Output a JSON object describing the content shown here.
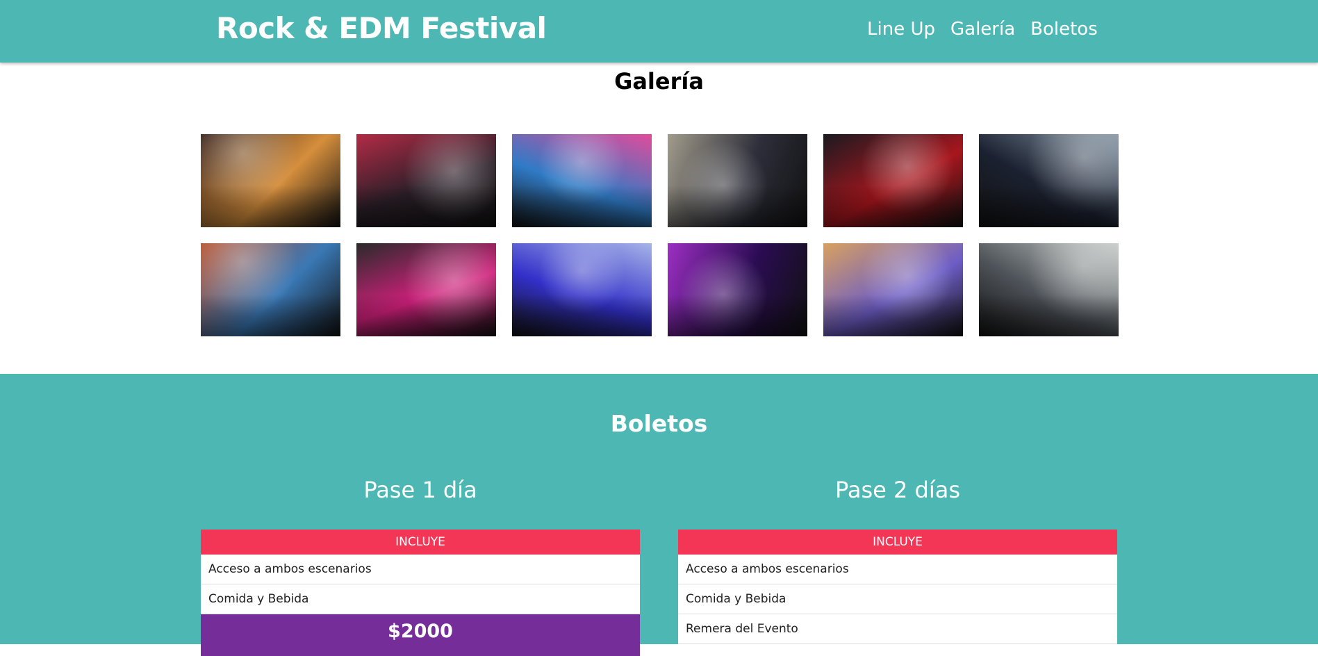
{
  "header": {
    "title": "Rock & EDM Festival",
    "nav": [
      "Line Up",
      "Galería",
      "Boletos"
    ]
  },
  "gallery": {
    "heading": "Galería",
    "photos": [
      {
        "name": "crowd-hands-orange-photo",
        "colors": [
          "#d58e3c",
          "#3a241c"
        ]
      },
      {
        "name": "rock-singer-red-photo",
        "colors": [
          "#2a1f28",
          "#b32b46"
        ]
      },
      {
        "name": "crowd-neon-lights-photo",
        "colors": [
          "#2f7bc6",
          "#e24b9b"
        ]
      },
      {
        "name": "dj-turntables-photo",
        "colors": [
          "#2d2e3a",
          "#a29c8c"
        ]
      },
      {
        "name": "guitarist-red-stage-photo",
        "colors": [
          "#a7161d",
          "#1a1a20"
        ]
      },
      {
        "name": "female-dj-photo",
        "colors": [
          "#1b2130",
          "#8596a6"
        ]
      },
      {
        "name": "guitars-closeup-photo",
        "colors": [
          "#3a78b5",
          "#b9502b"
        ]
      },
      {
        "name": "dj-laptop-crowd-photo",
        "colors": [
          "#d0207b",
          "#2a2a2a"
        ]
      },
      {
        "name": "dj-hand-blue-photo",
        "colors": [
          "#3230c9",
          "#a6b4e8"
        ]
      },
      {
        "name": "dj-controller-purple-photo",
        "colors": [
          "#2a0c52",
          "#9c2fc2"
        ]
      },
      {
        "name": "band-duo-stage-photo",
        "colors": [
          "#6d5dc6",
          "#d9a15e"
        ]
      },
      {
        "name": "singer-smoke-photo",
        "colors": [
          "#4e5359",
          "#c6cbc8"
        ]
      }
    ]
  },
  "tickets": {
    "heading": "Boletos",
    "passes": [
      {
        "title": "Pase 1 día",
        "includes_label": "INCLUYE",
        "items": [
          "Acceso a ambos escenarios",
          "Comida y Bebida"
        ],
        "price": "$2000"
      },
      {
        "title": "Pase 2 días",
        "includes_label": "INCLUYE",
        "items": [
          "Acceso a ambos escenarios",
          "Comida y Bebida",
          "Remera del Evento"
        ]
      }
    ]
  },
  "colors": {
    "teal": "#4db8b3",
    "pink": "#f33655",
    "purple": "#752d9a"
  }
}
